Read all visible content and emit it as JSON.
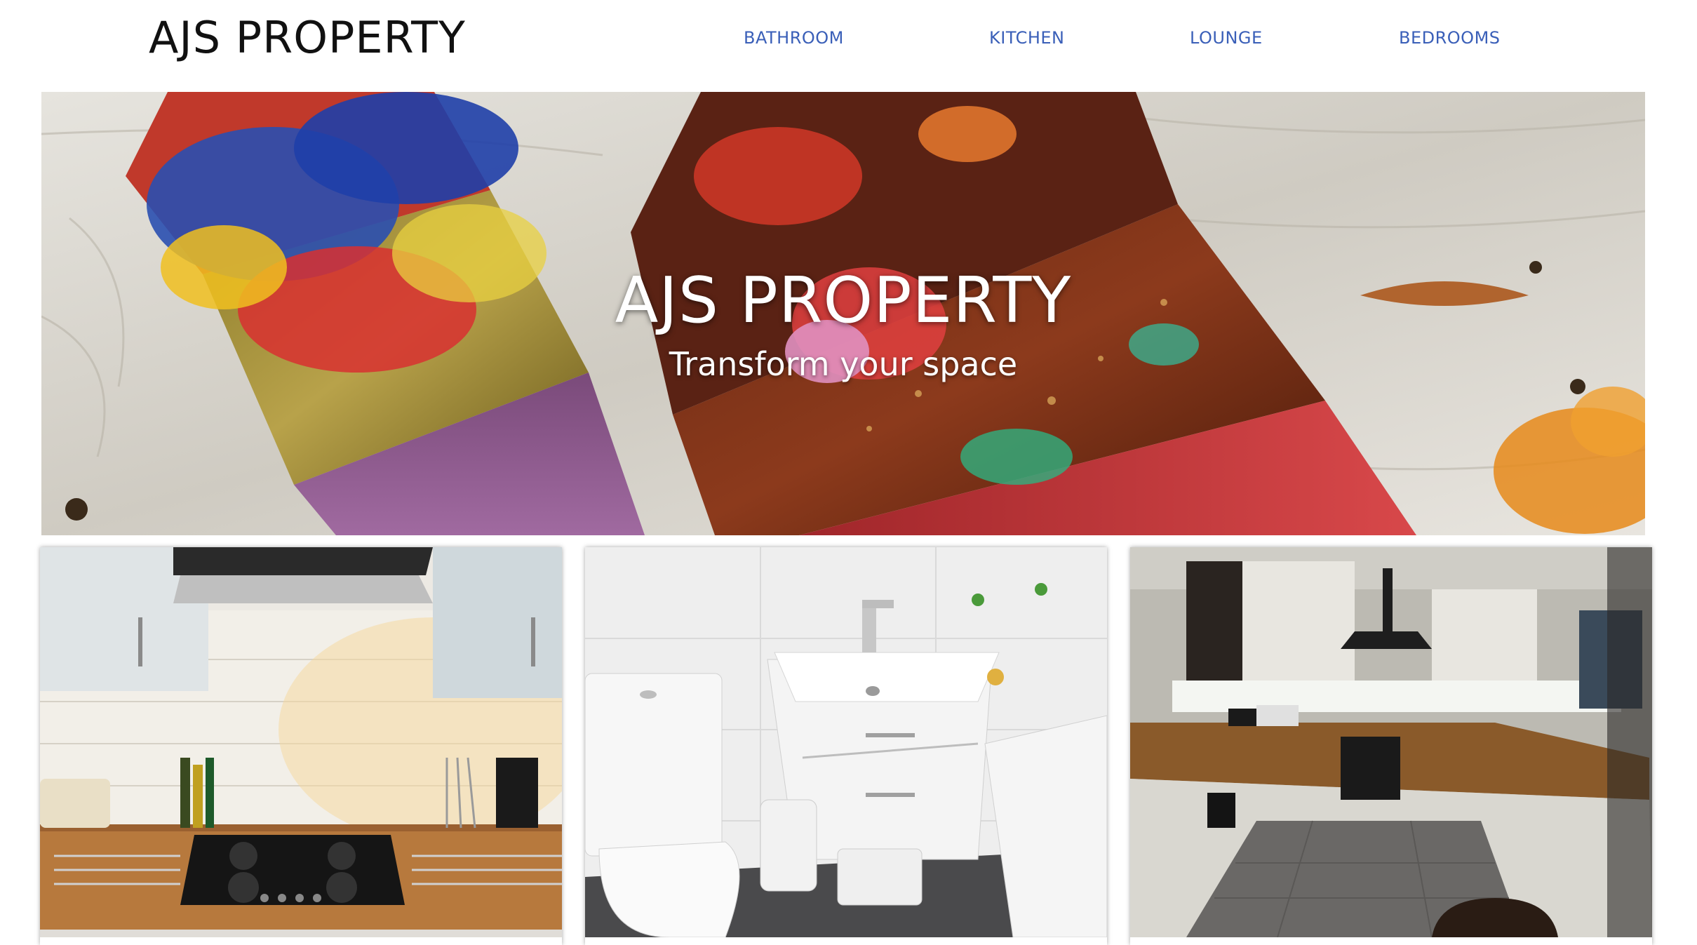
{
  "header": {
    "logo": "AJS PROPERTY",
    "nav": [
      {
        "label": "BATHROOM"
      },
      {
        "label": "KITCHEN"
      },
      {
        "label": "LOUNGE"
      },
      {
        "label": "BEDROOMS"
      }
    ]
  },
  "hero": {
    "title": "AJS PROPERTY",
    "subtitle": "Transform your space",
    "image": "paint-brushes-photo"
  },
  "gallery": [
    {
      "image": "kitchen-hob-photo"
    },
    {
      "image": "bathroom-sink-photo"
    },
    {
      "image": "kitchen-night-photo"
    }
  ],
  "colors": {
    "nav_link": "#3a5fb8",
    "logo": "#111111",
    "hero_text": "#ffffff",
    "background": "#ffffff"
  }
}
